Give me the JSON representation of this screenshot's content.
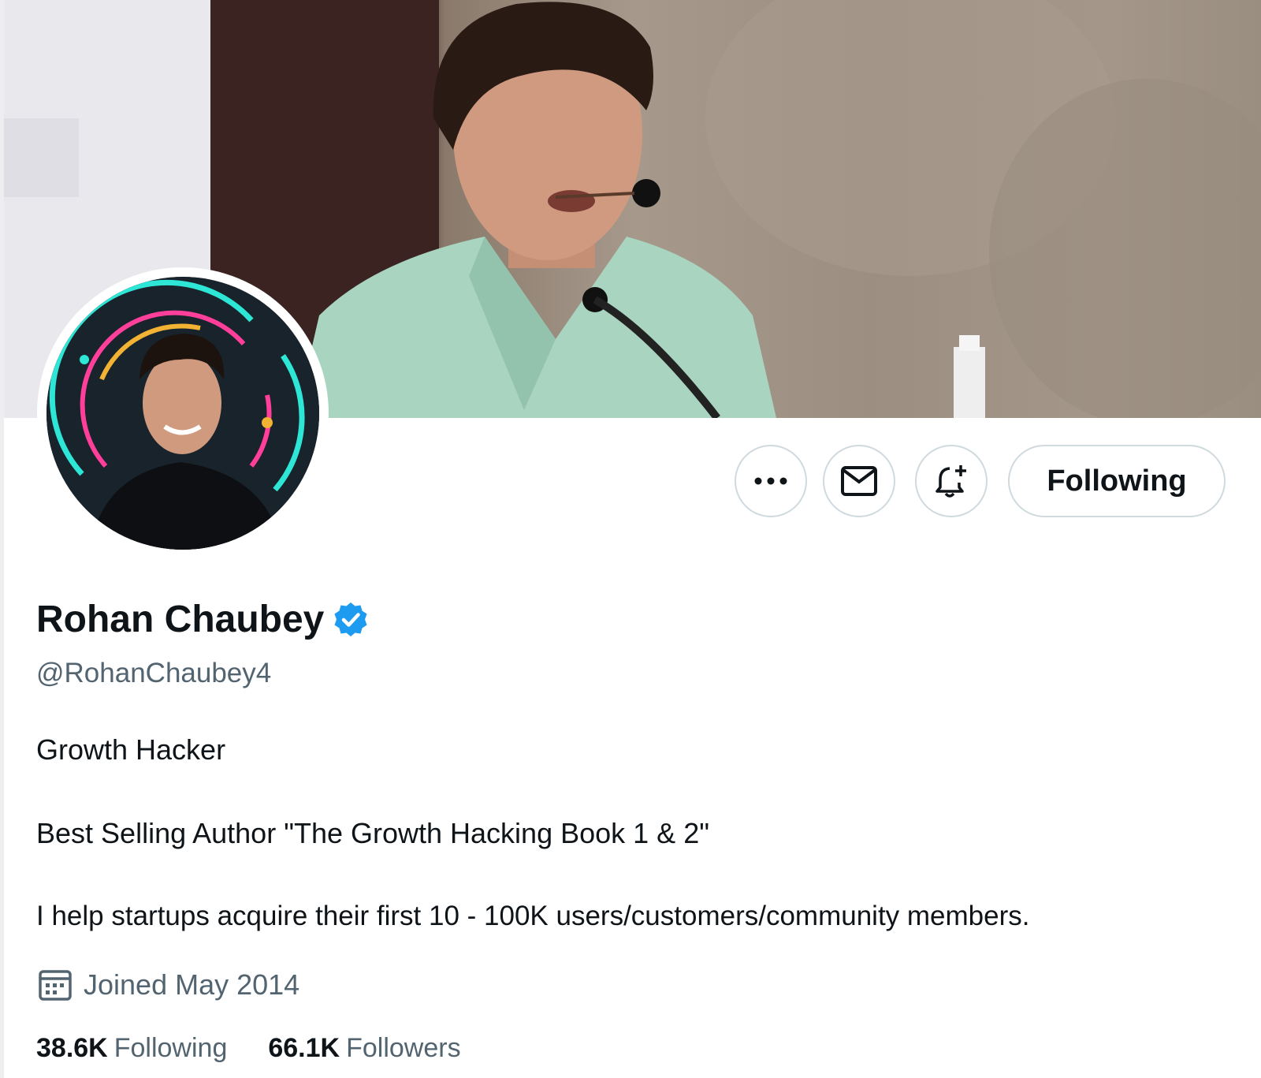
{
  "profile": {
    "display_name": "Rohan Chaubey",
    "handle": "@RohanChaubey4",
    "verified_icon": "verified-badge-icon",
    "bio": {
      "line1": "Growth Hacker",
      "line2": "Best Selling Author \"The Growth Hacking Book 1 & 2\"",
      "line3": "I help startups acquire their first 10 - 100K users/customers/community members."
    },
    "joined": "Joined May 2014",
    "stats": {
      "following_count": "38.6K",
      "following_label": "Following",
      "followers_count": "66.1K",
      "followers_label": "Followers"
    }
  },
  "actions": {
    "more_icon": "more-horizontal-icon",
    "message_icon": "envelope-icon",
    "notify_icon": "bell-plus-icon",
    "follow_label": "Following"
  },
  "colors": {
    "text_primary": "#0f1419",
    "text_secondary": "#536471",
    "verified_blue": "#1d9bf0",
    "border": "#cfd9de"
  }
}
